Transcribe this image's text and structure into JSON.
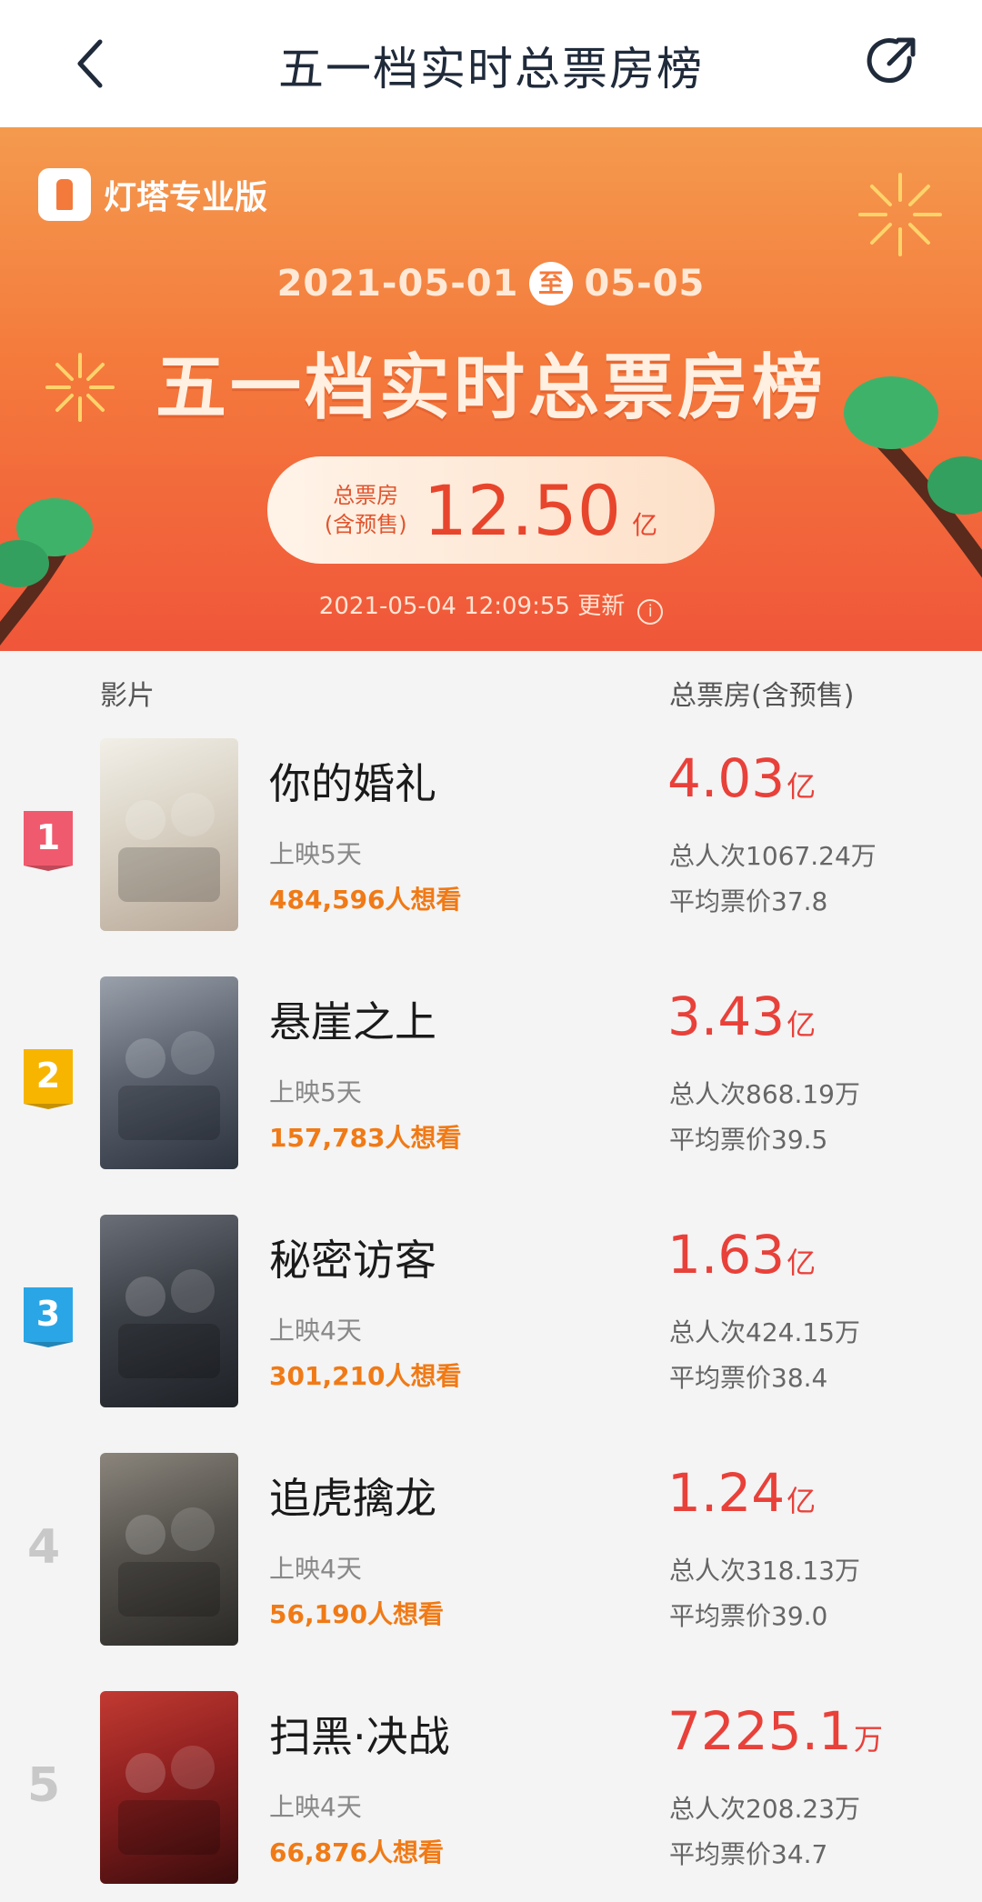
{
  "header": {
    "title": "五一档实时总票房榜"
  },
  "banner": {
    "brand": "灯塔专业版",
    "date_start": "2021-05-01",
    "date_sep": "至",
    "date_end": "05-05",
    "title": "五一档实时总票房榜",
    "total_label_1": "总票房",
    "total_label_2": "(含预售)",
    "total_value": "12.50",
    "total_unit": "亿",
    "updated": "2021-05-04 12:09:55 更新",
    "info_glyph": "i"
  },
  "columns": {
    "film": "影片",
    "box": "总票房(含预售)"
  },
  "colors": {
    "accent": "#e8413a",
    "orange": "#f07a16",
    "rank1": "#f05a6e",
    "rank2": "#f7b500",
    "rank3": "#2aa6e6"
  },
  "movies": [
    {
      "rank": "1",
      "title": "你的婚礼",
      "days": "上映5天",
      "want": "484,596人想看",
      "box": "4.03",
      "unit": "亿",
      "views": "总人次1067.24万",
      "avg": "平均票价37.8",
      "poster_colors": [
        "#d9d2c4",
        "#b9a99a",
        "#f2efe8"
      ]
    },
    {
      "rank": "2",
      "title": "悬崖之上",
      "days": "上映5天",
      "want": "157,783人想看",
      "box": "3.43",
      "unit": "亿",
      "views": "总人次868.19万",
      "avg": "平均票价39.5",
      "poster_colors": [
        "#5d6470",
        "#2d3440",
        "#9aa1ab"
      ]
    },
    {
      "rank": "3",
      "title": "秘密访客",
      "days": "上映4天",
      "want": "301,210人想看",
      "box": "1.63",
      "unit": "亿",
      "views": "总人次424.15万",
      "avg": "平均票价38.4",
      "poster_colors": [
        "#3b3f46",
        "#1f2227",
        "#6a6f78"
      ]
    },
    {
      "rank": "4",
      "title": "追虎擒龙",
      "days": "上映4天",
      "want": "56,190人想看",
      "box": "1.24",
      "unit": "亿",
      "views": "总人次318.13万",
      "avg": "平均票价39.0",
      "poster_colors": [
        "#55524d",
        "#2b2926",
        "#8b857c"
      ]
    },
    {
      "rank": "5",
      "title": "扫黑·决战",
      "days": "上映4天",
      "want": "66,876人想看",
      "box": "7225.1",
      "unit": "万",
      "views": "总人次208.23万",
      "avg": "平均票价34.7",
      "poster_colors": [
        "#8c1f1f",
        "#3a0c0c",
        "#c23a32"
      ]
    }
  ]
}
